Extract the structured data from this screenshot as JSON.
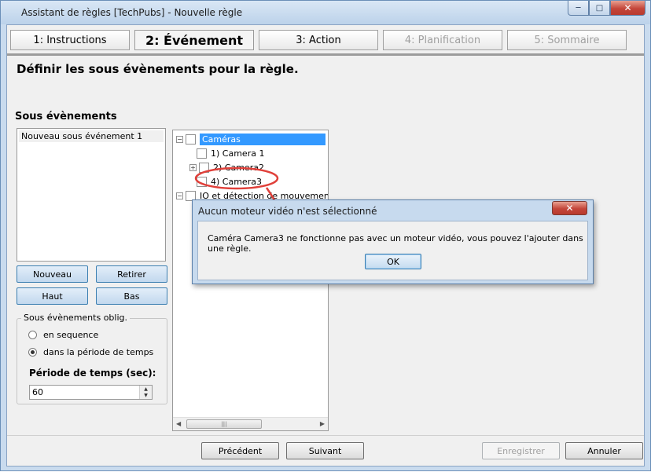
{
  "window": {
    "title": "Assistant de règles [TechPubs] - Nouvelle règle"
  },
  "tabs": [
    {
      "label": "1: Instructions",
      "state": "normal"
    },
    {
      "label": "2: Événement",
      "state": "active"
    },
    {
      "label": "3: Action",
      "state": "normal"
    },
    {
      "label": "4: Planification",
      "state": "disabled"
    },
    {
      "label": "5: Sommaire",
      "state": "disabled"
    }
  ],
  "page": {
    "heading": "Définir les sous évènements pour la règle."
  },
  "sub_events": {
    "title": "Sous évènements",
    "items": [
      "Nouveau sous événement 1"
    ],
    "buttons": {
      "new": "Nouveau",
      "remove": "Retirer",
      "up": "Haut",
      "down": "Bas"
    }
  },
  "options": {
    "legend": "Sous évènements oblig.",
    "radio_sequence": "en sequence",
    "radio_period": "dans la période de temps",
    "selected": "period",
    "period_label": "Période de temps (sec):",
    "period_value": "60"
  },
  "tree": {
    "root": "Caméras",
    "children": [
      "1) Camera 1",
      "2) Camera2",
      "4) Camera3"
    ],
    "second_root": "IO et détection de mouvement s"
  },
  "dialog": {
    "title": "Aucun moteur vidéo n'est sélectionné",
    "message": "Caméra Camera3 ne fonctionne pas avec un moteur vidéo, vous pouvez l'ajouter dans une règle.",
    "ok": "OK"
  },
  "footer": {
    "previous": "Précédent",
    "next": "Suivant",
    "save": "Enregistrer",
    "cancel": "Annuler"
  },
  "colors": {
    "selection": "#3399ff",
    "annotation": "#e0403a",
    "button_focus": "#3c7fb1"
  },
  "icons": {
    "minimize": "minimize-icon",
    "maximize": "maximize-icon",
    "close": "close-icon",
    "expand": "plus-icon",
    "collapse": "minus-icon"
  }
}
